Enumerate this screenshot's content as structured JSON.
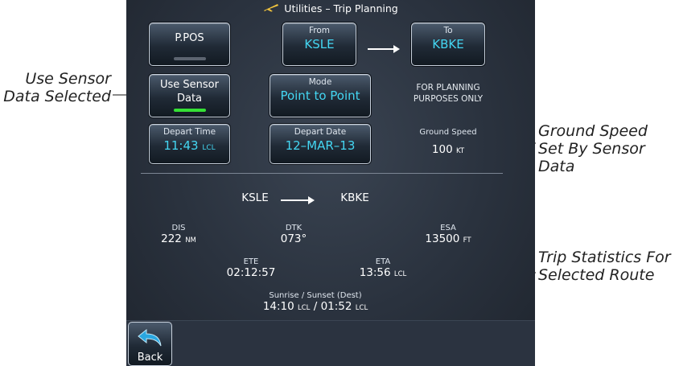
{
  "title": "Utilities – Trip Planning",
  "title_icon": "airplane-icon",
  "buttons": {
    "ppos": {
      "label": "P.POS"
    },
    "from": {
      "caption": "From",
      "value": "KSLE"
    },
    "to": {
      "caption": "To",
      "value": "KBKE"
    },
    "sensor": {
      "line1": "Use Sensor",
      "line2": "Data"
    },
    "mode": {
      "caption": "Mode",
      "value": "Point to Point"
    },
    "depart_time": {
      "caption": "Depart Time",
      "value": "11:43",
      "unit": "LCL"
    },
    "depart_date": {
      "caption": "Depart Date",
      "value": "12–MAR–13"
    }
  },
  "notice": {
    "line1": "FOR PLANNING",
    "line2": "PURPOSES ONLY"
  },
  "ground_speed": {
    "label": "Ground Speed",
    "value": "100",
    "unit": "KT"
  },
  "route": {
    "from": "KSLE",
    "to": "KBKE"
  },
  "stats": {
    "dis": {
      "label": "DIS",
      "value": "222",
      "unit": "NM"
    },
    "dtk": {
      "label": "DTK",
      "value": "073°"
    },
    "esa": {
      "label": "ESA",
      "value": "13500",
      "unit": "FT"
    },
    "ete": {
      "label": "ETE",
      "value": "02:12:57"
    },
    "eta": {
      "label": "ETA",
      "value": "13:56",
      "unit": "LCL"
    },
    "sun": {
      "label": "Sunrise / Sunset (Dest)",
      "rise": "14:10",
      "set": "01:52",
      "unit": "LCL",
      "sep": "/"
    }
  },
  "back": {
    "label": "Back"
  },
  "callouts": {
    "left": {
      "line1": "Use Sensor",
      "line2": "Data Selected"
    },
    "ground_speed": {
      "line1": "Ground Speed",
      "line2": "Set By Sensor",
      "line3": "Data"
    },
    "trip": {
      "line1": "Trip Statistics For",
      "line2": "Selected Route"
    }
  },
  "colors": {
    "cyan": "#44d6f2",
    "green_indicator": "#35e035",
    "screen_bg": "#2a323e"
  }
}
